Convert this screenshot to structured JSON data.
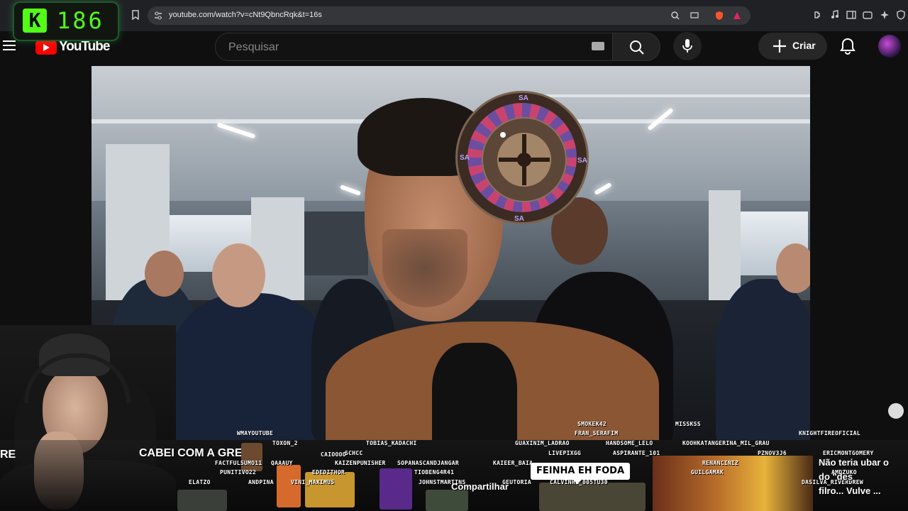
{
  "browser": {
    "url": "youtube.com/watch?v=cNt9QbncRqk&t=16s"
  },
  "overlay_counter": {
    "logo": "K",
    "count": "186"
  },
  "youtube": {
    "logo_text": "YouTube",
    "search_placeholder": "Pesquisar",
    "create_label": "Criar"
  },
  "roulette": {
    "label": "SA"
  },
  "stream_overlay": {
    "left_text": "RE",
    "marquee": "CABEI COM A GREVE!",
    "bubble": "FEINHA EH FODA",
    "share_label": "Compartilhar",
    "right_lines": [
      "Não teria ubar o",
      "do \"des",
      "filro... Vulve ..."
    ],
    "chat_names": [
      "WMAYOUTUBE",
      "TOXON_2",
      "TOBIAS_KADACHI",
      "GUAXINIM_LADRAO",
      "SMOKEK42",
      "FRAN_SERAFIM",
      "HANDSOME_LELO",
      "MISSKSS",
      "KNIGHTFIREOFICIAL",
      "FACTFULSUMO11",
      "QAAAUY",
      "CAIOOOO",
      "SCHCC",
      "KAIZENPUNISHER",
      "SOPANASCANDJANGAR",
      "KAIEER_BAIA",
      "LIVEPIXGG",
      "ASPIRANTE_101",
      "KOOHKATANGERINA_MIL_GRAU",
      "PZNOV3J6",
      "ERICMONTGOMERY",
      "PUNITIVO22",
      "EDEDITHOR",
      "TIOBENG4R41",
      "RENANCINIZ",
      "GUILGAMAK",
      "AMDZUKO",
      "ELATZO",
      "ANDPINA",
      "VINI_MAXIMUS",
      "JOHNSTMARTINS",
      "GEUTORIA",
      "CALVINHL_005TU30",
      "DASILVA_RIVERDREW"
    ]
  },
  "colors": {
    "kick_green": "#53fc18",
    "youtube_red": "#ff0000",
    "background": "#0f0f0f"
  }
}
